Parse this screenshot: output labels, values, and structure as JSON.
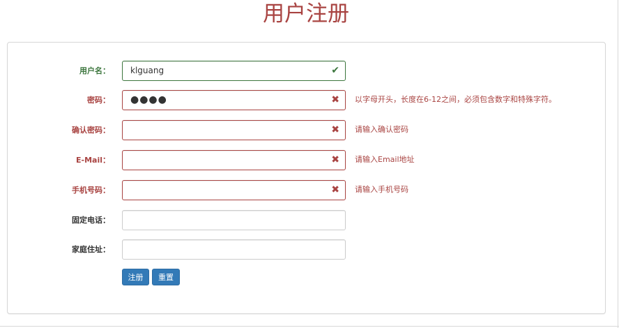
{
  "title": "用户注册",
  "form": {
    "username": {
      "label": "用户名：",
      "value": "klguang",
      "status": "ok",
      "icon": "check-icon",
      "icon_glyph": "✔",
      "help": ""
    },
    "password": {
      "label": "密码：",
      "value": "●●●●",
      "status": "error",
      "icon": "close-icon",
      "icon_glyph": "✖",
      "help": "以字母开头，长度在6-12之间，必须包含数字和特殊字符。"
    },
    "confirm_password": {
      "label": "确认密码：",
      "value": "",
      "status": "error",
      "icon": "close-icon",
      "icon_glyph": "✖",
      "help": "请输入确认密码"
    },
    "email": {
      "label": "E-Mail：",
      "value": "",
      "status": "error",
      "icon": "close-icon",
      "icon_glyph": "✖",
      "help": "请输入Email地址"
    },
    "mobile": {
      "label": "手机号码：",
      "value": "",
      "status": "error",
      "icon": "close-icon",
      "icon_glyph": "✖",
      "help": "请输入手机号码"
    },
    "phone": {
      "label": "固定电话：",
      "value": ""
    },
    "address": {
      "label": "家庭住址：",
      "value": ""
    }
  },
  "buttons": {
    "register": "注册",
    "reset": "重置"
  },
  "colors": {
    "error": "#a94442",
    "success": "#3c763d",
    "primary": "#337ab7"
  }
}
